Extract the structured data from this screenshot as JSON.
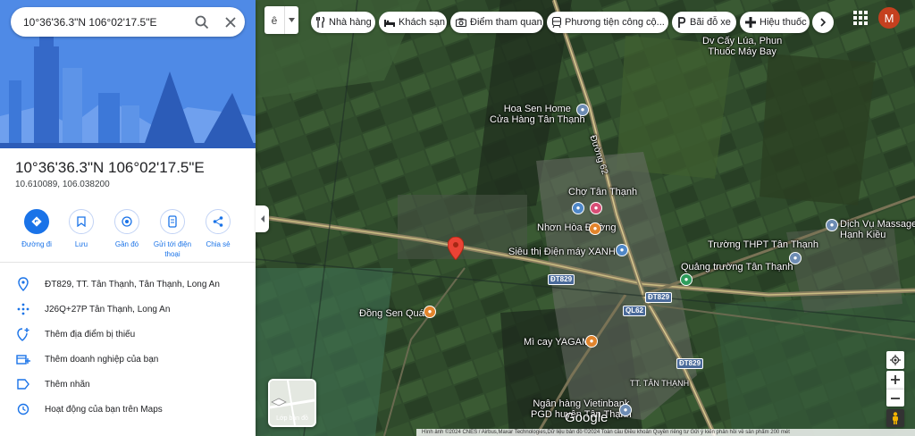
{
  "search": {
    "query": "10°36'36.3\"N 106°02'17.5\"E"
  },
  "place": {
    "title": "10°36'36.3\"N 106°02'17.5\"E",
    "coordinates": "10.610089, 106.038200"
  },
  "actions": [
    {
      "label": "Đường đi",
      "icon": "directions-icon",
      "primary": true
    },
    {
      "label": "Lưu",
      "icon": "bookmark-icon"
    },
    {
      "label": "Gần đó",
      "icon": "nearby-icon"
    },
    {
      "label": "Gửi tới điện thoại",
      "icon": "send-to-phone-icon"
    },
    {
      "label": "Chia sẻ",
      "icon": "share-icon"
    }
  ],
  "info_rows": [
    {
      "text": "ĐT829, TT. Tân Thạnh, Tân Thạnh, Long An",
      "icon": "location-pin-icon"
    },
    {
      "text": "J26Q+27P Tân Thạnh, Long An",
      "icon": "plus-code-icon"
    },
    {
      "text": "Thêm địa điểm bị thiếu",
      "icon": "add-place-icon"
    },
    {
      "text": "Thêm doanh nghiệp của bạn",
      "icon": "add-business-icon"
    },
    {
      "text": "Thêm nhãn",
      "icon": "label-icon"
    },
    {
      "text": "Hoạt động của bạn trên Maps",
      "icon": "history-icon"
    }
  ],
  "lang_selector": {
    "current": "ê"
  },
  "chips": [
    {
      "label": "Nhà hàng",
      "icon": "restaurant-icon"
    },
    {
      "label": "Khách sạn",
      "icon": "hotel-icon"
    },
    {
      "label": "Điểm tham quan",
      "icon": "camera-icon"
    },
    {
      "label": "Phương tiện công cộ...",
      "icon": "transit-icon"
    },
    {
      "label": "Bãi đỗ xe",
      "icon": "parking-icon"
    },
    {
      "label": "Hiệu thuốc",
      "icon": "pharmacy-icon"
    }
  ],
  "user": {
    "initial": "M"
  },
  "layers_label": "Lớp bản đồ",
  "map_labels": [
    {
      "text": "Dv Cấy Lúa, Phun",
      "text2": "Thuốc Máy Bay"
    },
    {
      "text": "Hoa Sen Home",
      "text2": "Cửa Hàng Tân Thạnh"
    },
    {
      "text": "Chợ Tân Thạnh"
    },
    {
      "text": "Nhơn Hòa Đường"
    },
    {
      "text": "Siêu thị Điện máy XANH"
    },
    {
      "text": "Dịch Vụ Massage",
      "text2": "Hạnh Kiều"
    },
    {
      "text": "Trường THPT Tân Thạnh"
    },
    {
      "text": "Quảng trường Tân Thạnh"
    },
    {
      "text": "Đồng Sen Quán"
    },
    {
      "text": "Mì cay YAGAMI"
    },
    {
      "text": "TT. TÂN THẠNH"
    },
    {
      "text": "Ngân hàng Vietinbank",
      "text2": "PGD huyện Tân Thạnh"
    },
    {
      "text": "Đường 62"
    }
  ],
  "road_shields": [
    "ĐT829",
    "ĐT829",
    "QL62",
    "ĐT829"
  ],
  "logo_text": "Google",
  "footer": "Hình ảnh ©2024 CNES / Airbus,Maxar Technologies,Dữ liệu bản đồ ©2024   Toàn cầu   Điều khoản   Quyền riêng tư   Gửi ý kiến phản hồi về sản phẩm   200 mét"
}
